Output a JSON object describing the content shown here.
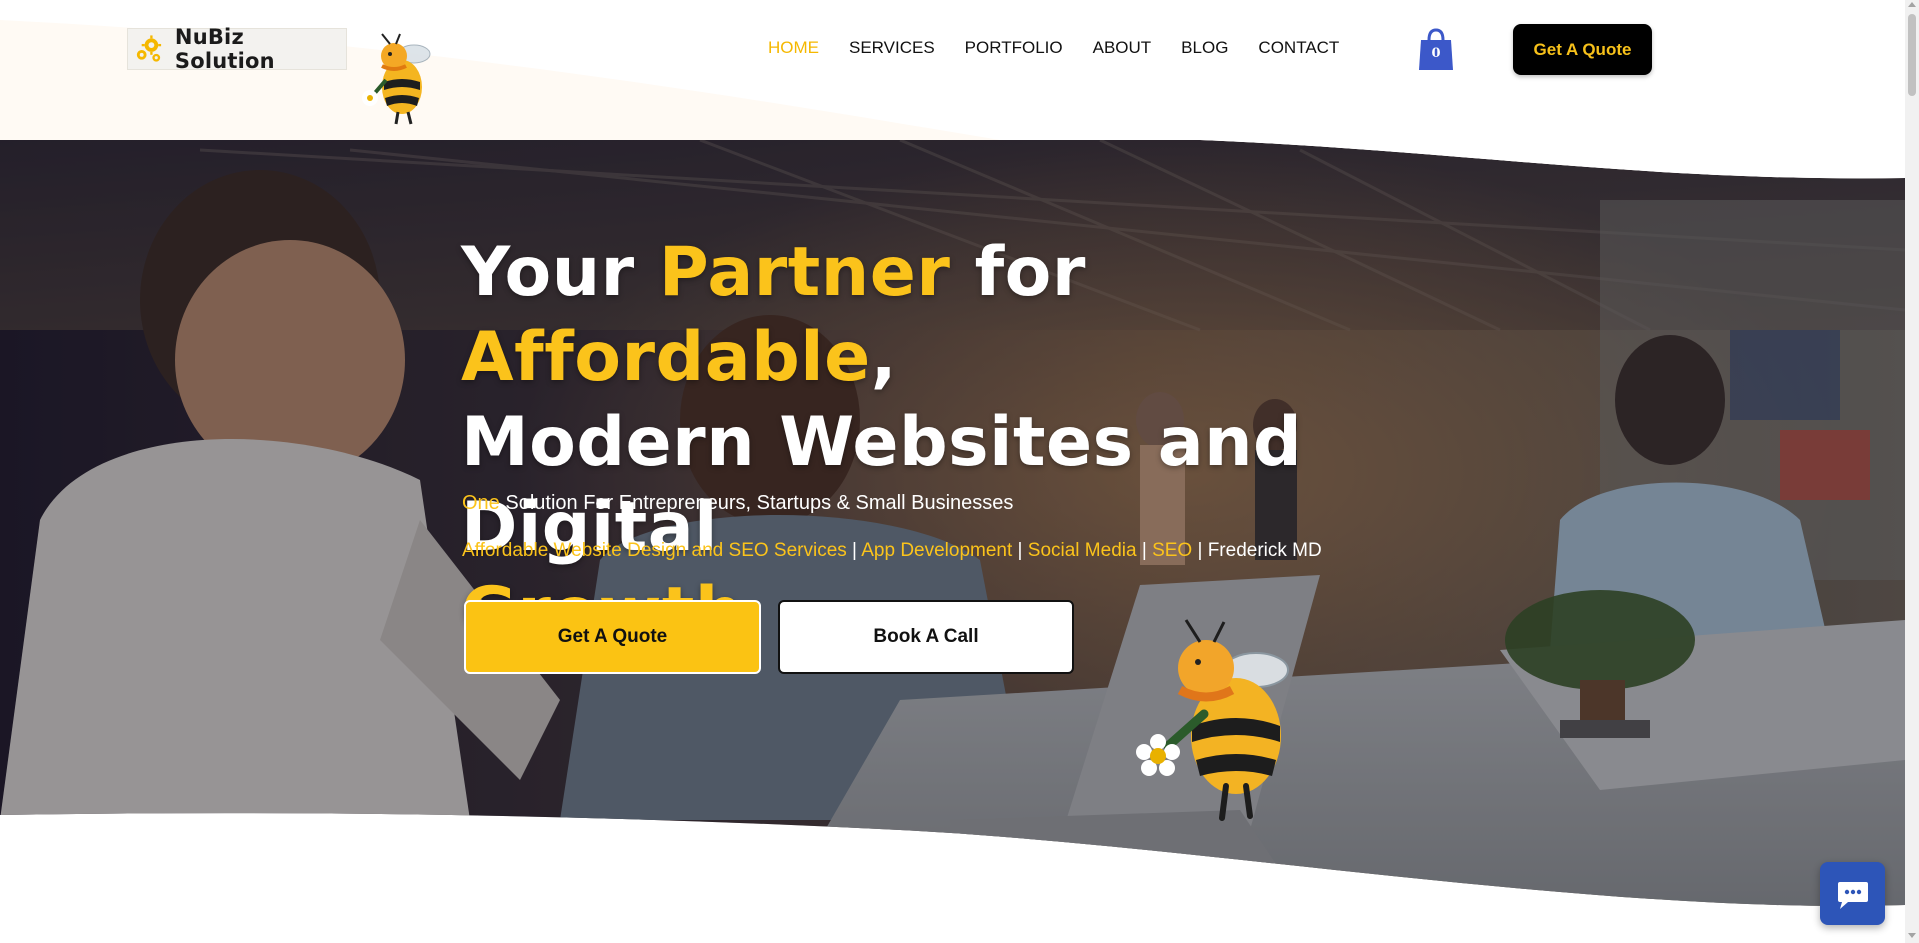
{
  "brand": {
    "name": "NuBiz Solution",
    "logo_icon": "gears-icon",
    "mascot_icon": "bee-mascot-icon"
  },
  "nav": {
    "items": [
      {
        "label": "HOME",
        "active": true
      },
      {
        "label": "SERVICES",
        "active": false
      },
      {
        "label": "PORTFOLIO",
        "active": false
      },
      {
        "label": "ABOUT",
        "active": false
      },
      {
        "label": "BLOG",
        "active": false
      },
      {
        "label": "CONTACT",
        "active": false
      }
    ]
  },
  "cart": {
    "icon": "shopping-bag-icon",
    "count": "0"
  },
  "header_cta": {
    "label": "Get A Quote"
  },
  "hero": {
    "headline": {
      "w1": "Your",
      "w2": "Partner",
      "w3": "for",
      "w4": "Affordable",
      "w5": ",",
      "line2": "Modern Websites and Digital",
      "line3": "Growth"
    },
    "subline": {
      "highlight": "One",
      "rest": " Solution For Entrepreneurs, Startups & Small Businesses"
    },
    "services": {
      "s1": "Affordable Website Design and SEO Services",
      "sep": " | ",
      "s2": "App Development",
      "s3": "Social Media",
      "s4": "SEO",
      "location": "Frederick MD"
    },
    "primary_cta": "Get A Quote",
    "secondary_cta": "Book A Call"
  },
  "chat": {
    "icon": "chat-bubble-icon"
  },
  "colors": {
    "accent": "#fbc31b",
    "nav_active": "#f5b800",
    "cart": "#3c58c9",
    "chat": "#2d55b8",
    "header_bg": "#fffaf4"
  }
}
